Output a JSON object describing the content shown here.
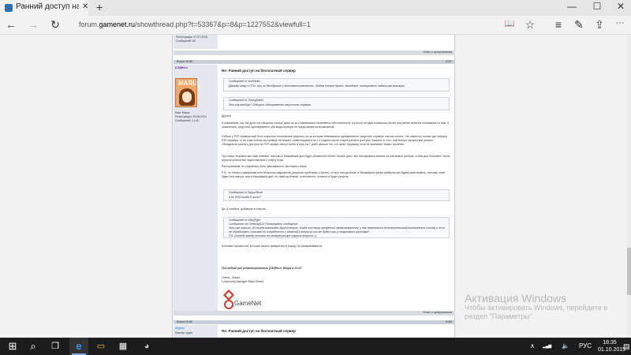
{
  "tab": {
    "title": "Ранний доступ на бесп",
    "close_glyph": "✕",
    "new_tab_glyph": "+"
  },
  "window_controls": {
    "minimize": "—",
    "maximize": "☐",
    "close": "✕"
  },
  "address": {
    "prefix": "forum.",
    "host": "gamenet.ru",
    "path": "/showthread.php?t=53367&p=8&p=1227552&viewfull=1"
  },
  "nav": {
    "back": "←",
    "forward": "→",
    "refresh": "↻"
  },
  "toolbar": {
    "reading_view": "📖",
    "favorite": "☆",
    "hub": "≡",
    "note": "✎",
    "share": "⇪",
    "more": "···"
  },
  "forum": {
    "top_meta_1": "Регистрация: 07.07.2015",
    "top_meta_2": "Сообщений: 60",
    "reply_btn": "Ответ с цитированием",
    "post": {
      "date": "Вчера 16:08",
      "number": "#157",
      "username": "[CM]Hero",
      "title": "Re: Ранний доступ на бесплатный сервер",
      "avatar_text": "MARU",
      "user_meta_1": "Имя: Маша",
      "user_meta_2": "Регистрация: 25.08.2014",
      "user_meta_3": "Сообщений: 2,140",
      "quote1_author": "Сообщение от xeoRadeL",
      "quote1_text": "Дважды инфу о ППЗ. что за бесобразие и безответственность. Людям отпуск брать. выходные. планировать надела как минимум...",
      "quote2_author": "Сообщение от StrongSabel",
      "quote2_text": "Это как вообще? Обещали одновременно запустить сервера.",
      "greeting": "Друзья!",
      "para1": "К сожалению, мы так долго не говорили точные даты из-за сложившихся негативных обстоятельств, и только сегодня появилось более или менее внятное понимание по ним. К сожалению, запустить одновременно оба вида сервера не представляется возможным.",
      "para2": "Сейчас у P2P сервера ещё есть открытые технические вопросы, из-за которых невозможно одновременно запустить сервера, как мы хотели. Что касается точных дат запуска P2P сервера, то их пока сейчас мы назвать не можем, ориентируемся на 1-2 недели после старта раннего доступа. Зависит от того, как быстро сможем все решить. Обладатели раннего доступа на P2P сервер смогут войти в игру на 7 дней раньше тех, кто купит подписку, если не возникнет новых проблем.",
      "para3": "Про наши отправки мы тоже помним, поэтому в ближайшие дни будут объявлены более точные даты, мы постараемся сказать их как можно раньше, чтобы для большего числа игроков успели все подготовиться к старту игры.",
      "para4": "Расстраиваем, но стараемся быть максимально честными с вами.",
      "para5": "P.S.: по теням и фамилиям есть несколько вариантов (решение проблемы о броне), но все они удобные, в ближайшее время выберем как будем действовать, поэтому ответ будет или завтра, или в ближайшие дни; но сама проблема, естественно, понятна и будет решена.",
      "quote3_author": "Сообщение от Вуууа'белег",
      "quote3_text": "а по 3000 когда 8 число?",
      "para6": "Да, 8 октября, добавили в новость.",
      "quote4_author": "Сообщение от WingTiger",
      "quote4_line1": "Сообщение от SeekingG33 Посмотреть сообщение",
      "quote4_line2": "Это уже хорошо, но тогда возникает другой вопрос. Когда костюмы профессий запаковываются, у нас появляются дополнительные(исключаемые слоты) и если не обработать свиншот по очередности с заменой(3 вопроса) или же будет как у стартового костюма?",
      "quote4_line3": "P.S. Отсебя заводу описаны не интересующие игроков вопросы =)",
      "para7": "Костюмы профессий, которые можно превратить в наряд, не запаковываются.",
      "edited": "Последний раз редактировалось [CM]Hero; Вчера в 21:07.",
      "sig_line1": "Олеся - Маша",
      "sig_line2": "Community Manager Black Desert",
      "gamenet": "GameNet"
    },
    "next_post": {
      "date": "Вчера 16:08",
      "number": "#158",
      "username": "Aegelio",
      "user_meta_1": "Мастер чудес",
      "title": "Re: Ранний доступ на бесплатный сервер"
    }
  },
  "watermark": {
    "title": "Активация Windows",
    "text": "Чтобы активировать Windows, перейдите в раздел \"Параметры\"."
  },
  "taskbar": {
    "start": "⊞",
    "search": "⌕",
    "taskview": "❐",
    "edge": "e",
    "explorer": "▭",
    "store": "▦",
    "app": "◕",
    "tray_chevron": "∧",
    "tray_network": "▂▄▆",
    "tray_volume": "🔈",
    "tray_lang": "РУС",
    "time": "18:35",
    "date": "01.10.2015",
    "notification": "▤"
  },
  "colors": {
    "accent": "#1e73cc",
    "taskbar": "#1c1c1c",
    "forum_bar": "#c9cfd8",
    "watermark": "#b7b7b7"
  }
}
